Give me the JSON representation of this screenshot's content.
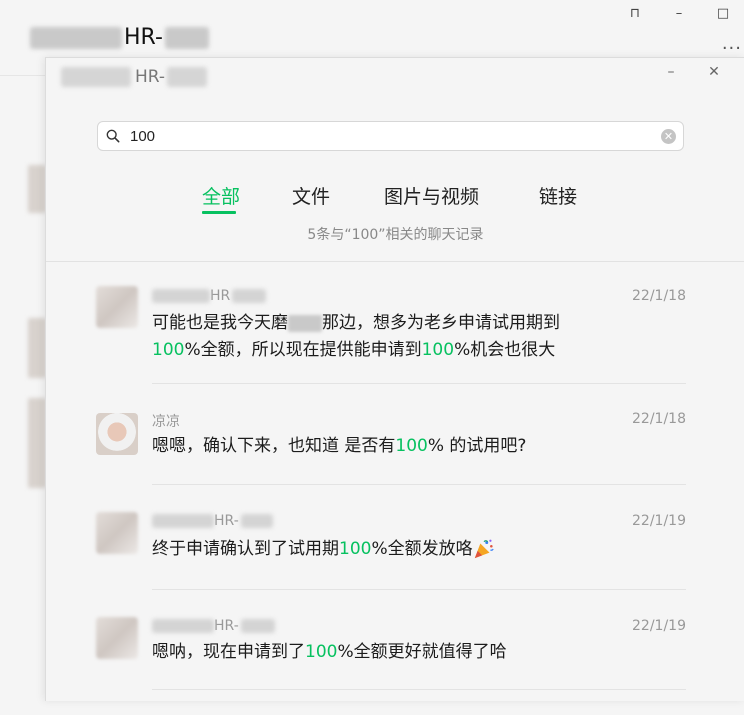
{
  "window": {
    "title": "HR-",
    "controls": {
      "pin": "⊓",
      "minimize": "–",
      "maximize": "□",
      "more": "···"
    }
  },
  "dialog": {
    "title": "HR-",
    "minimize": "–",
    "close": "✕",
    "search": {
      "value": "100"
    },
    "tabs": [
      {
        "label": "全部",
        "active": true
      },
      {
        "label": "文件"
      },
      {
        "label": "图片与视频"
      },
      {
        "label": "链接"
      }
    ],
    "result_count": "5条与“100”相关的聊天记录",
    "results": [
      {
        "sender": "HR",
        "date": "22/1/18",
        "msg_parts": [
          "可能也是我今天磨",
          "那边，想多为老乡申请试用期到",
          "100",
          "%全额，所以现在提供能申请到",
          "100",
          "%机会也很大"
        ]
      },
      {
        "sender": "凉凉",
        "date": "22/1/18",
        "msg_parts": [
          "嗯嗯，确认下来，也知道 是否有",
          "100",
          "% 的试用吧?"
        ]
      },
      {
        "sender": "HR-",
        "date": "22/1/19",
        "msg_parts": [
          "终于申请确认到了试用期",
          "100",
          "%全额发放咯"
        ]
      },
      {
        "sender": "HR-",
        "date": "22/1/19",
        "msg_parts": [
          "嗯呐，现在申请到了",
          "100",
          "%全额更好就值得了哈"
        ]
      }
    ]
  },
  "colors": {
    "accent": "#07c160",
    "background": "#f5f5f5",
    "muted_text": "#999999"
  }
}
